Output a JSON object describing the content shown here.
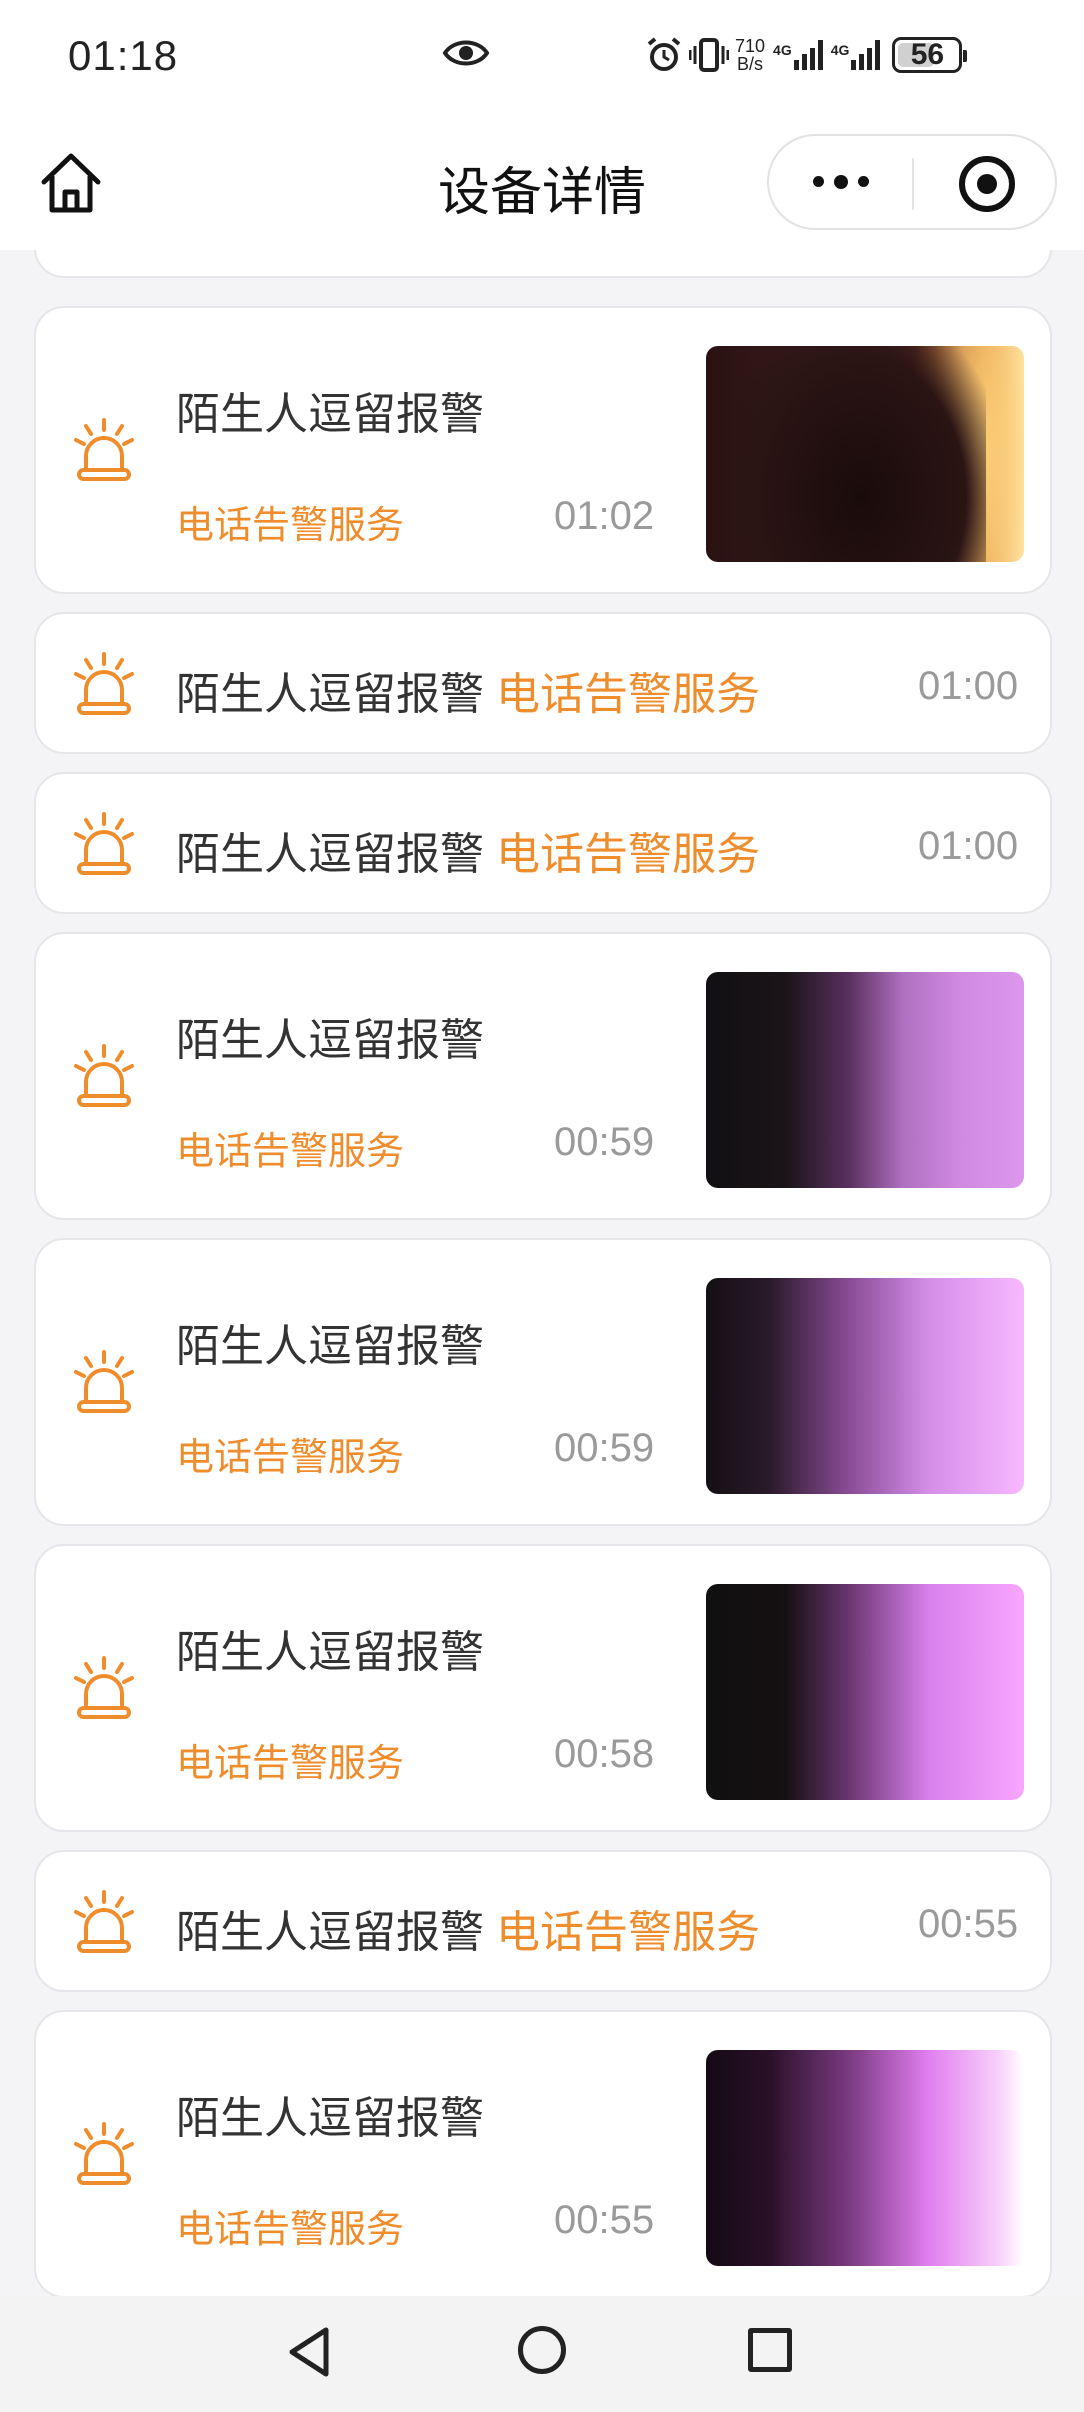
{
  "status_bar": {
    "time": "01:18",
    "net_speed_value": "710",
    "net_speed_unit": "B/s",
    "signal_1_label": "4G",
    "signal_2_label": "4G",
    "battery_level": "56",
    "icons": [
      "eye-icon",
      "alarm-clock-icon",
      "vibrate-icon",
      "signal-icon",
      "battery-icon"
    ]
  },
  "nav": {
    "title": "设备详情",
    "icons": [
      "home-icon",
      "more-icon",
      "target-icon"
    ]
  },
  "accent_color": "#ef8c2c",
  "alarms": [
    {
      "title": "陌生人逗留报警",
      "service": "电话告警服务",
      "time": "01:02",
      "has_thumbnail": true
    },
    {
      "title": "陌生人逗留报警",
      "service": "电话告警服务",
      "time": "01:00",
      "has_thumbnail": false
    },
    {
      "title": "陌生人逗留报警",
      "service": "电话告警服务",
      "time": "01:00",
      "has_thumbnail": false
    },
    {
      "title": "陌生人逗留报警",
      "service": "电话告警服务",
      "time": "00:59",
      "has_thumbnail": true
    },
    {
      "title": "陌生人逗留报警",
      "service": "电话告警服务",
      "time": "00:59",
      "has_thumbnail": true
    },
    {
      "title": "陌生人逗留报警",
      "service": "电话告警服务",
      "time": "00:58",
      "has_thumbnail": true
    },
    {
      "title": "陌生人逗留报警",
      "service": "电话告警服务",
      "time": "00:55",
      "has_thumbnail": false
    },
    {
      "title": "陌生人逗留报警",
      "service": "电话告警服务",
      "time": "00:55",
      "has_thumbnail": true
    }
  ],
  "system_nav": {
    "icons": [
      "back-icon",
      "home-circle-icon",
      "recent-apps-icon"
    ]
  }
}
